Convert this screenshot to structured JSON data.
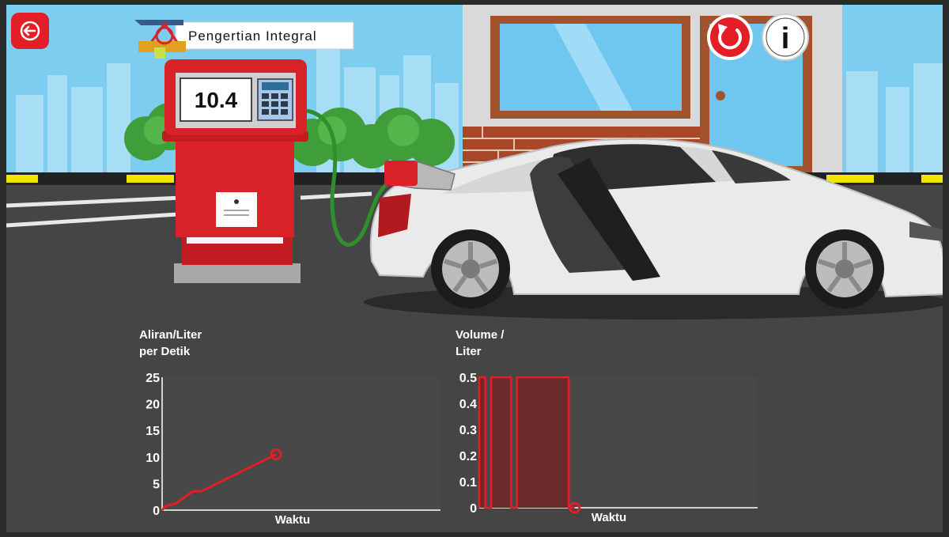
{
  "app": {
    "title": "Pengertian Integral",
    "pump_display": "10.4",
    "buttons": {
      "back": "back-arrow-icon",
      "reset": "refresh-icon",
      "info": "info-icon",
      "info_glyph": "i"
    }
  },
  "colors": {
    "accent_red": "#e41e26",
    "sky": "#7dcdf0",
    "asphalt": "#454545",
    "plot_bg": "#484848",
    "fill_red": "#6b2a2a"
  },
  "chart_data": [
    {
      "type": "line",
      "ylabel": "Aliran/Liter per Detik",
      "ylabel_lines": [
        "Aliran/Liter",
        "per Detik"
      ],
      "xlabel": "Waktu",
      "ylim": [
        0,
        25
      ],
      "yticks": [
        "0",
        "5",
        "10",
        "15",
        "20",
        "25"
      ],
      "series": [
        {
          "x": [
            0,
            0.3,
            1,
            2.3,
            3,
            8.6
          ],
          "y": [
            0,
            0.8,
            1.2,
            3.5,
            3.6,
            10.5
          ]
        }
      ],
      "marker_last": true
    },
    {
      "type": "area",
      "ylabel": "Volume / Liter",
      "ylabel_lines": [
        "Volume /",
        "Liter"
      ],
      "xlabel": "Waktu",
      "ylim": [
        0,
        0.5
      ],
      "yticks": [
        "0",
        "0.1",
        "0.2",
        "0.3",
        "0.4",
        "0.5"
      ],
      "segments": [
        {
          "x0": 0.0,
          "x1": 0.3,
          "y": 0.5
        },
        {
          "x0": 0.6,
          "x1": 1.6,
          "y": 0.5
        },
        {
          "x0": 1.9,
          "x1": 4.5,
          "y": 0.5
        }
      ],
      "marker": {
        "x": 4.8,
        "y": 0
      }
    }
  ]
}
